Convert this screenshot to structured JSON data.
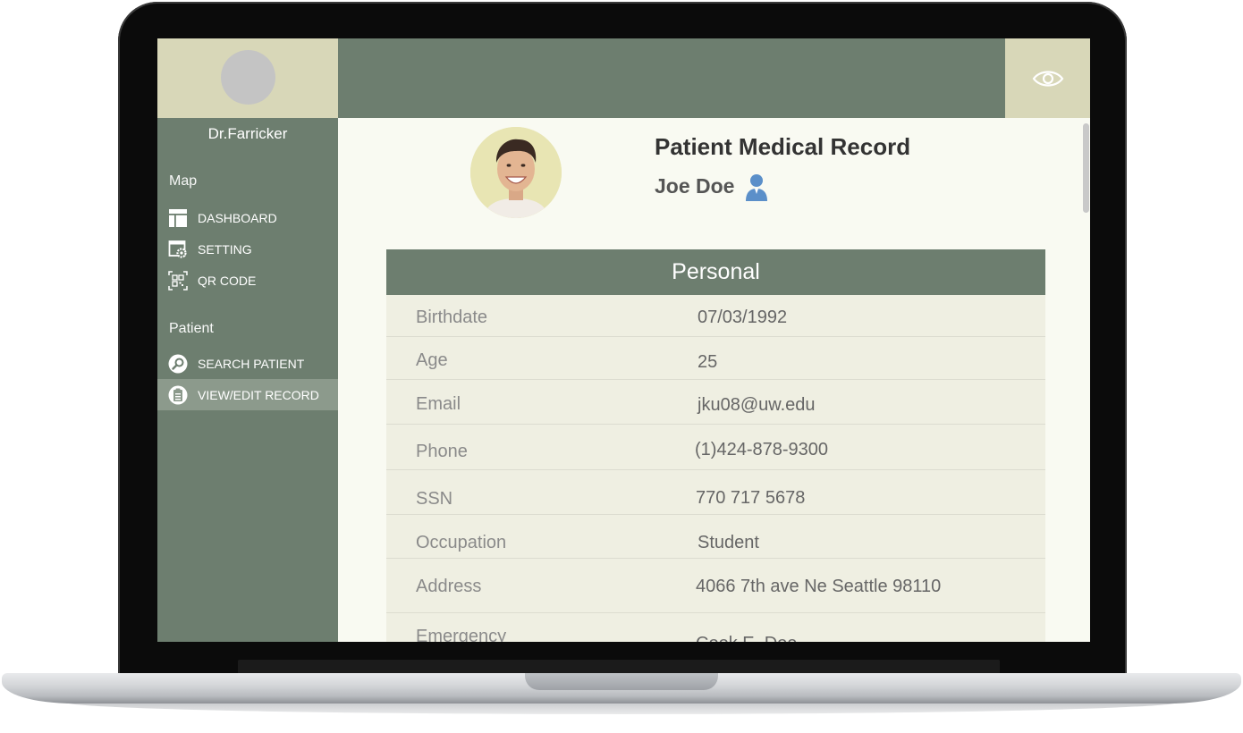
{
  "sidebar": {
    "doctor_name": "Dr.Farricker",
    "sections": [
      {
        "label": "Map",
        "items": [
          {
            "label": "DASHBOARD",
            "icon": "dashboard-icon"
          },
          {
            "label": "SETTING",
            "icon": "settings-window-icon"
          },
          {
            "label": "QR CODE",
            "icon": "qr-code-icon"
          }
        ]
      },
      {
        "label": "Patient",
        "items": [
          {
            "label": "SEARCH PATIENT",
            "icon": "search-icon"
          },
          {
            "label": "VIEW/EDIT RECORD",
            "icon": "clipboard-icon",
            "active": true
          }
        ]
      }
    ]
  },
  "header": {
    "view_icon": "eye-icon"
  },
  "record": {
    "title": "Patient Medical Record",
    "patient_name": "Joe Doe",
    "patient_icon": "person-icon",
    "section_title": "Personal",
    "rows": [
      {
        "label": "Birthdate",
        "value": "07/03/1992"
      },
      {
        "label": "Age",
        "value": "25"
      },
      {
        "label": "Email",
        "value": "jku08@uw.edu"
      },
      {
        "label": "Phone",
        "value": "(1)424-878-9300"
      },
      {
        "label": "SSN",
        "value": "770 717 5678"
      },
      {
        "label": "Occupation",
        "value": "Student"
      },
      {
        "label": "Address",
        "value": "4066 7th ave Ne Seattle 98110"
      },
      {
        "label": "Emergency",
        "value": "Cook E. Doe"
      }
    ]
  },
  "colors": {
    "sage": "#6d7e6f",
    "beige": "#d8d7b8",
    "content_bg": "#f9faf2",
    "table_bg": "#efefe2",
    "active_item": "#8c9a8c",
    "person_icon": "#5b8fc9"
  }
}
